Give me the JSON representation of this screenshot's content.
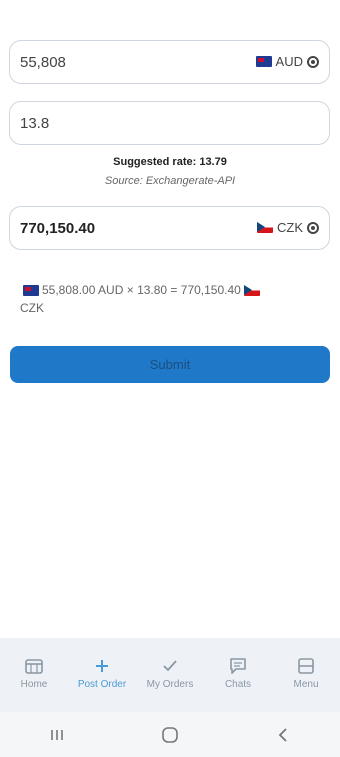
{
  "from_field": {
    "value": "55,808",
    "currency": "AUD"
  },
  "rate_field": {
    "value": "13.8"
  },
  "suggested": {
    "label": "Suggested rate: 13.79",
    "source": "Source: Exchangerate-API"
  },
  "to_field": {
    "value": "770,150.40",
    "currency": "CZK"
  },
  "calculation": {
    "left": "55,808.00 AUD × 13.80 = 770,150.40",
    "right": "CZK"
  },
  "submit": {
    "label": "Submit"
  },
  "nav": {
    "items": [
      {
        "label": "Home",
        "icon": "calendar-icon"
      },
      {
        "label": "Post Order",
        "icon": "plus-icon",
        "active": true
      },
      {
        "label": "My Orders",
        "icon": "check-icon"
      },
      {
        "label": "Chats",
        "icon": "chat-bubble-icon"
      },
      {
        "label": "Menu",
        "icon": "menu-icon"
      }
    ]
  },
  "colors": {
    "accent": "#1f78c8",
    "nav_active": "#4a9ad6",
    "nav_bg": "#eef2f6"
  }
}
